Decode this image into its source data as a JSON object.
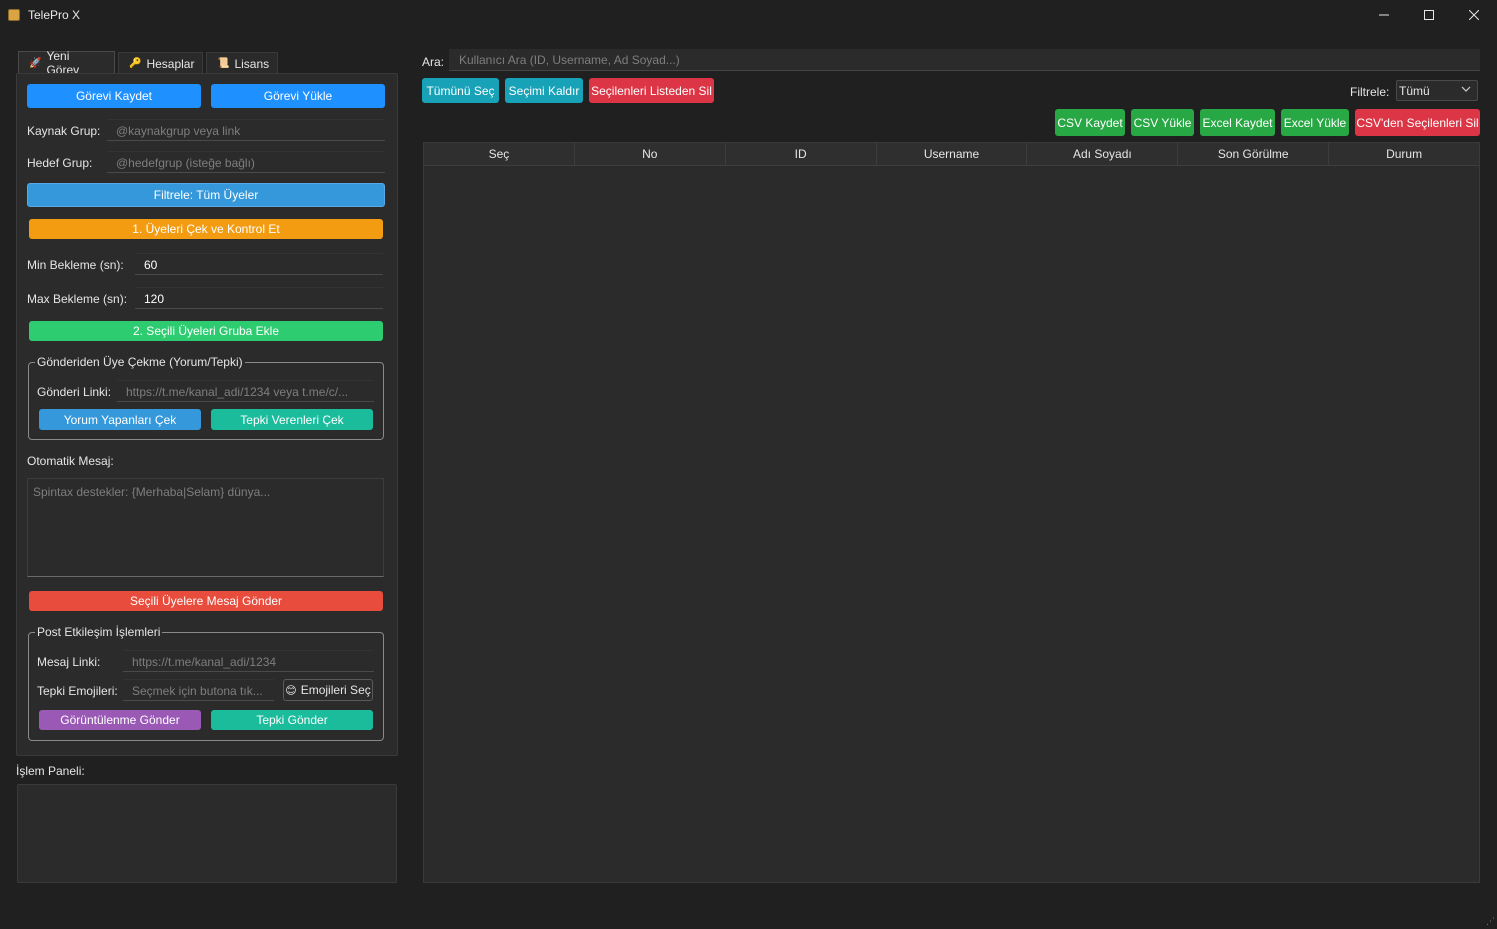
{
  "window": {
    "title": "TelePro X",
    "icon": "package-icon"
  },
  "tabs": [
    {
      "label": "Yeni Görev",
      "icon": "rocket-icon",
      "glyph": "🚀",
      "active": true
    },
    {
      "label": "Hesaplar",
      "icon": "key-icon",
      "glyph": "🔑",
      "active": false
    },
    {
      "label": "Lisans",
      "icon": "scroll-icon",
      "glyph": "📜",
      "active": false
    }
  ],
  "task": {
    "save_label": "Görevi Kaydet",
    "load_label": "Görevi Yükle",
    "source_label": "Kaynak Grup:",
    "source_placeholder": "@kaynakgrup veya link",
    "target_label": "Hedef Grup:",
    "target_placeholder": "@hedefgrup (isteğe bağlı)",
    "filter_label": "Filtrele: Tüm Üyeler",
    "fetch_label": "1. Üyeleri Çek ve Kontrol Et",
    "min_wait_label": "Min Bekleme (sn):",
    "min_wait_value": "60",
    "max_wait_label": "Max Bekleme (sn):",
    "max_wait_value": "120",
    "add_label": "2. Seçili Üyeleri Gruba Ekle"
  },
  "post_fetch": {
    "title": "Gönderiden Üye Çekme (Yorum/Tepki)",
    "link_label": "Gönderi Linki:",
    "link_placeholder": "https://t.me/kanal_adi/1234 veya t.me/c/...",
    "comments_label": "Yorum Yapanları Çek",
    "reactions_label": "Tepki Verenleri Çek"
  },
  "auto_message": {
    "label": "Otomatik Mesaj:",
    "placeholder": "Spintax destekler: {Merhaba|Selam} dünya...",
    "send_label": "Seçili Üyelere Mesaj Gönder"
  },
  "post_interaction": {
    "title": "Post Etkileşim İşlemleri",
    "link_label": "Mesaj Linki:",
    "link_placeholder": "https://t.me/kanal_adi/1234",
    "emoji_label": "Tepki Emojileri:",
    "emoji_placeholder": "Seçmek için butona tık...",
    "emoji_button": "Emojileri Seç",
    "emoji_glyph": "😊",
    "views_label": "Görüntülenme Gönder",
    "reaction_label": "Tepki Gönder"
  },
  "log": {
    "label": "İşlem Paneli:"
  },
  "search": {
    "label": "Ara:",
    "placeholder": "Kullanıcı Ara (ID, Username, Ad Soyad...)"
  },
  "actions": {
    "select_all": "Tümünü Seç",
    "clear_selection": "Seçimi Kaldır",
    "delete_selected": "Seçilenleri Listeden Sil",
    "filter_label": "Filtrele:",
    "filter_value": "Tümü",
    "csv_save": "CSV Kaydet",
    "csv_load": "CSV Yükle",
    "excel_save": "Excel Kaydet",
    "excel_load": "Excel Yükle",
    "csv_delete": "CSV'den Seçilenleri Sil"
  },
  "table": {
    "columns": [
      "Seç",
      "No",
      "ID",
      "Username",
      "Adı Soyadı",
      "Son Görülme",
      "Durum"
    ],
    "rows": []
  },
  "colors": {
    "background": "#202020",
    "panel": "#2b2b2b",
    "blue": "#1e90ff",
    "orange": "#f39c12",
    "green": "#2ecc71",
    "red": "#e74c3c",
    "teal": "#1abc9c",
    "purple": "#9b59b6"
  }
}
